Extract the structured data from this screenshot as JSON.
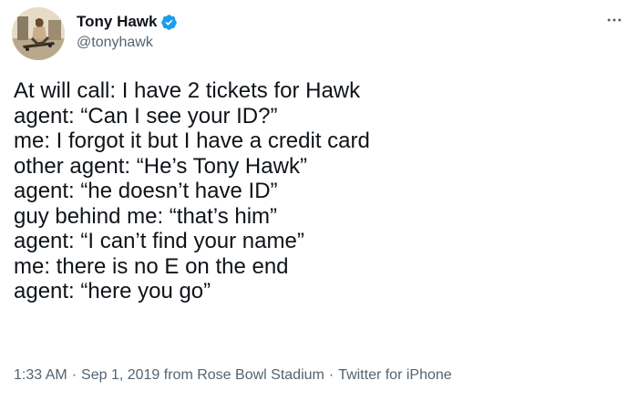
{
  "author": {
    "display_name": "Tony Hawk",
    "handle": "@tonyhawk",
    "verified": true,
    "verified_color": "#1d9bf0"
  },
  "tweet": {
    "lines": [
      "At will call: I have 2 tickets for Hawk",
      "agent: “Can I see your ID?”",
      "me: I forgot it but I have a credit card",
      "other agent: “He’s Tony Hawk”",
      "agent: “he doesn’t have ID”",
      "guy behind me: “that’s him”",
      "agent: “I can’t find your name”",
      "me: there is no E on the end",
      "agent: “here you go”"
    ]
  },
  "meta": {
    "time": "1:33 AM",
    "date": "Sep 1, 2019",
    "location": "from Rose Bowl Stadium",
    "source": "Twitter for iPhone",
    "separator": "·"
  },
  "icons": {
    "more": "more-horizontal-icon",
    "verified": "verified-badge-icon"
  },
  "colors": {
    "text_primary": "#0f1419",
    "text_secondary": "#536471",
    "background": "#ffffff"
  }
}
